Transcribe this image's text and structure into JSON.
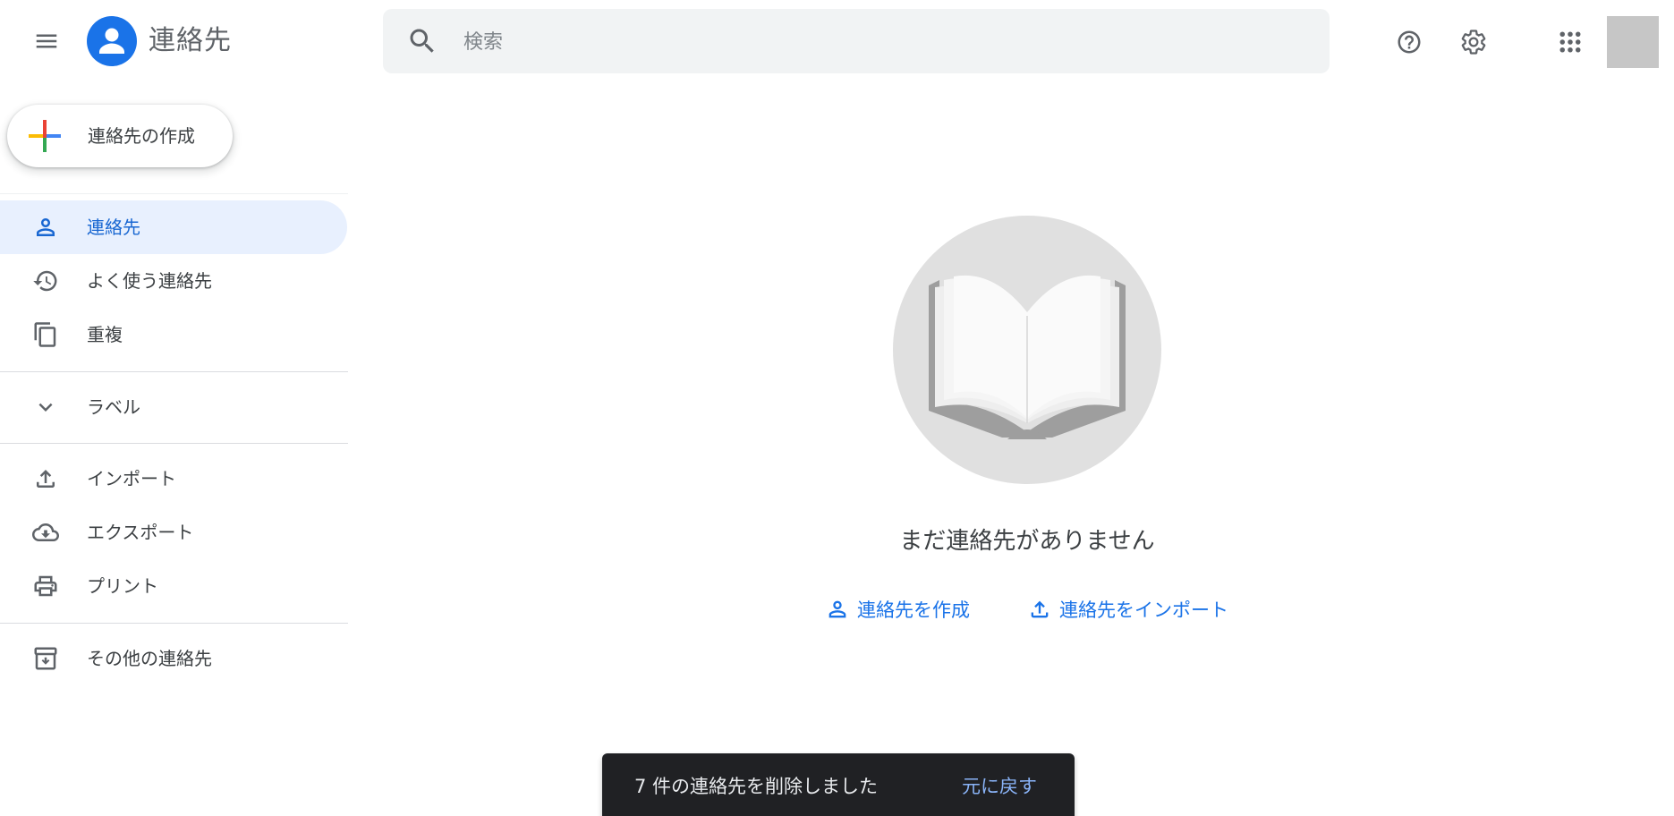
{
  "header": {
    "app_title": "連絡先",
    "search_placeholder": "検索",
    "search_value": "",
    "icons": {
      "menu": "hamburger-menu-icon",
      "logo": "contacts-person-logo",
      "search": "search-icon",
      "help": "help-circle-icon",
      "settings": "gear-icon",
      "apps": "apps-grid-icon"
    }
  },
  "sidebar": {
    "create_label": "連絡先の作成",
    "items": [
      {
        "label": "連絡先",
        "icon": "person-icon",
        "active": true
      },
      {
        "label": "よく使う連絡先",
        "icon": "history-icon",
        "active": false
      },
      {
        "label": "重複",
        "icon": "copy-icon",
        "active": false
      },
      {
        "label": "ラベル",
        "icon": "chevron-down-icon",
        "active": false
      },
      {
        "label": "インポート",
        "icon": "upload-icon",
        "active": false
      },
      {
        "label": "エクスポート",
        "icon": "cloud-download-icon",
        "active": false
      },
      {
        "label": "プリント",
        "icon": "printer-icon",
        "active": false
      },
      {
        "label": "その他の連絡先",
        "icon": "archive-icon",
        "active": false
      }
    ]
  },
  "empty_state": {
    "illustration": "open-book-illustration",
    "title": "まだ連絡先がありません",
    "actions": [
      {
        "label": "連絡先を作成",
        "icon": "person-icon"
      },
      {
        "label": "連絡先をインポート",
        "icon": "upload-icon"
      }
    ]
  },
  "snackbar": {
    "message": "7 件の連絡先を削除しました",
    "action_label": "元に戻す"
  },
  "colors": {
    "accent": "#1a73e8",
    "active_bg": "#e8f0fe",
    "active_text": "#1967d2",
    "snackbar_bg": "#202124",
    "snackbar_action": "#8ab4f8",
    "search_bg": "#f1f3f4"
  }
}
